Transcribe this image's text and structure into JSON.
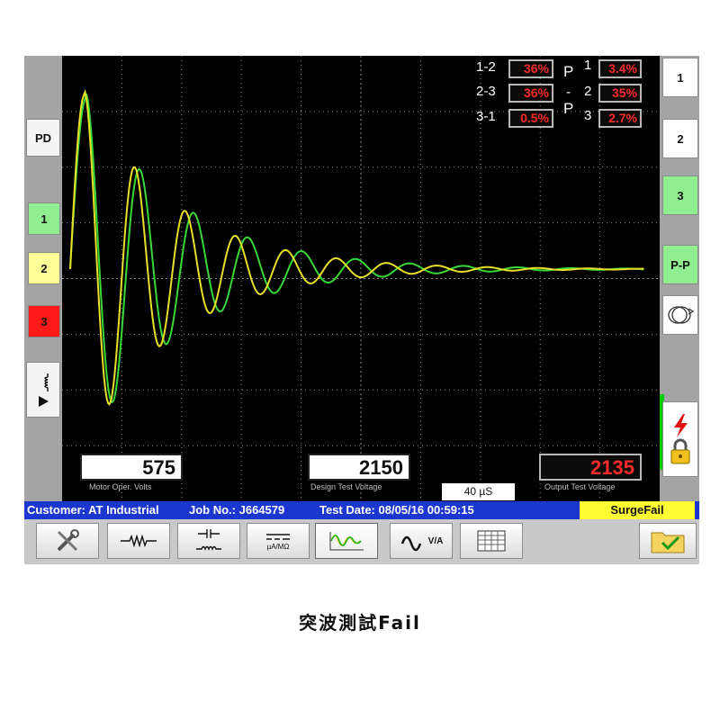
{
  "left_panel": {
    "pd_label": "PD",
    "channels": [
      {
        "label": "1",
        "color": "#90ee90"
      },
      {
        "label": "2",
        "color": "#ffff99"
      },
      {
        "label": "3",
        "color": "#ff1a1a"
      }
    ]
  },
  "right_panel": {
    "buttons": [
      {
        "label": "1",
        "color": "#ffffff"
      },
      {
        "label": "2",
        "color": "#ffffff"
      },
      {
        "label": "3",
        "color": "#90ee90"
      },
      {
        "label": "P-P",
        "color": "#90ee90"
      }
    ],
    "level_fill": 0.28,
    "level_color": "#00cc00"
  },
  "measurements": {
    "rows": [
      {
        "label": "1-2",
        "value": "36%"
      },
      {
        "label": "2-3",
        "value": "36%"
      },
      {
        "label": "3-1",
        "value": "0.5%"
      }
    ],
    "p_values": [
      {
        "value": "3.4%"
      },
      {
        "value": "35%"
      },
      {
        "value": "2.7%"
      }
    ],
    "p_labels": [
      "P",
      "1",
      "-",
      "2",
      "P",
      "3"
    ]
  },
  "readouts": {
    "motor": {
      "value": "575",
      "caption": "Motor Oper. Volts"
    },
    "design": {
      "value": "2150",
      "caption": "Design Test Voltage"
    },
    "output": {
      "value": "2135",
      "caption": "Output Test Voltage"
    },
    "timebase": "40 µS"
  },
  "info_bar": {
    "customer": "Customer: AT Industrial",
    "job": "Job No.: J664579",
    "test_date": "Test Date: 08/05/16 00:59:15",
    "status": "SurgeFail"
  },
  "toolbar": {
    "buttons": [
      "wrench-icon",
      "resistor-icon",
      "capacitor-coil-icon",
      "meter-icon",
      "surge-wave-icon",
      "ac-voltage-icon",
      "table-icon"
    ],
    "meter_label": "µA/MΩ",
    "ac_label": "V/A"
  },
  "caption": "突波測試Fail",
  "colors": {
    "trace_green": "#38d838",
    "trace_yellow": "#e8e02a",
    "info_blue": "#1c37d0",
    "fail_yellow": "#ffff33"
  }
}
